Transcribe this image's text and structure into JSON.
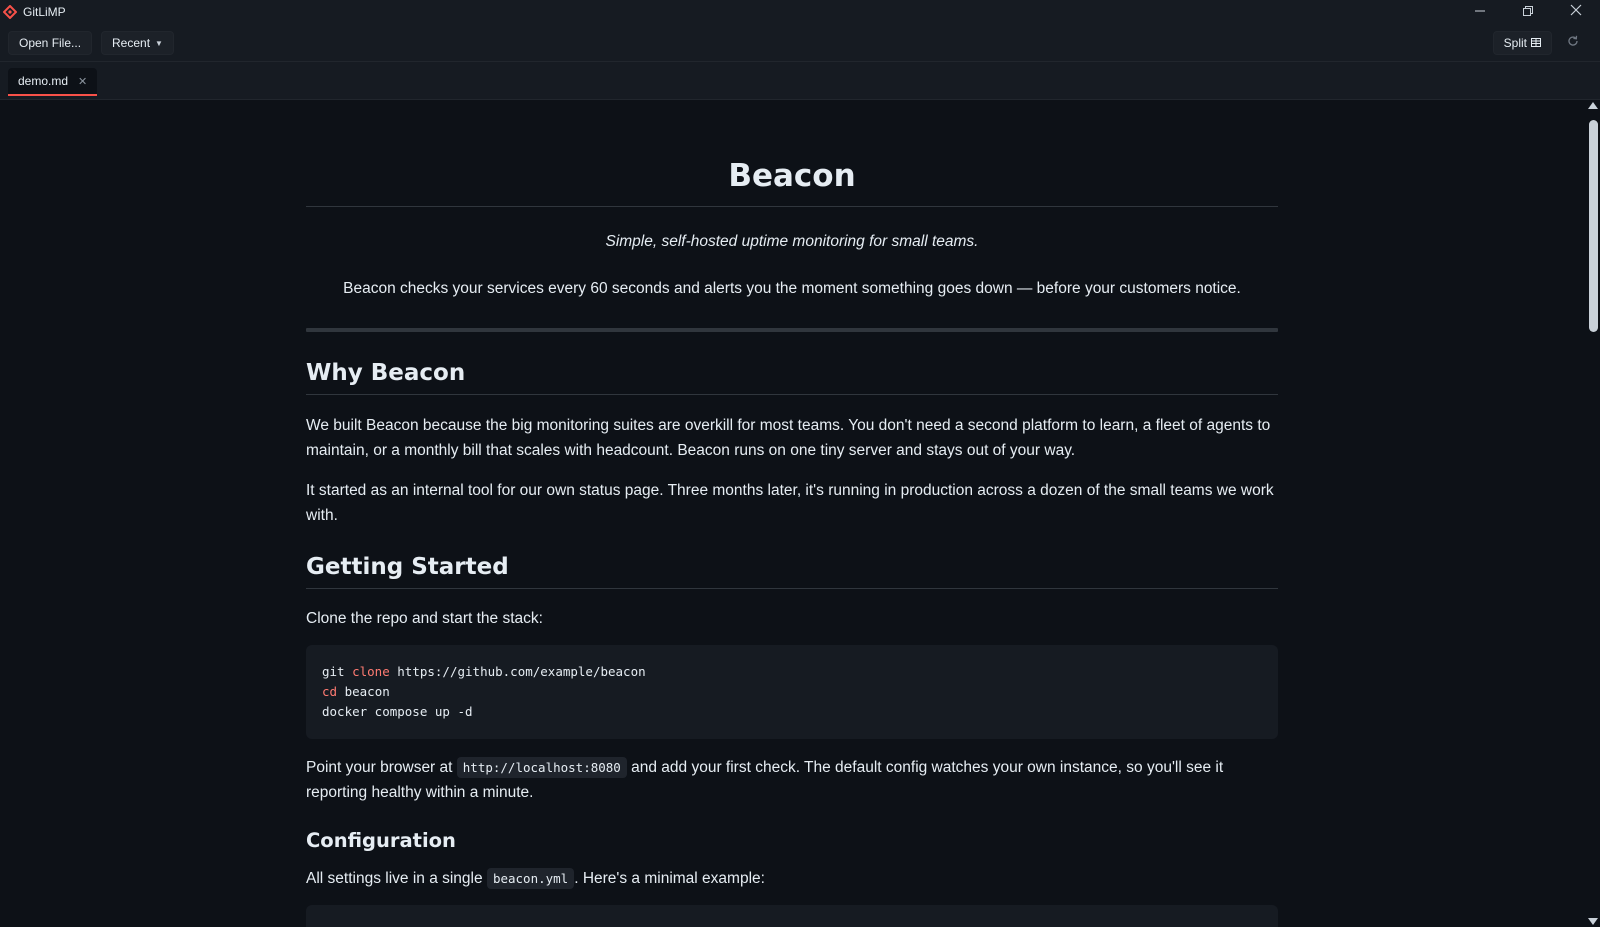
{
  "window": {
    "title": "GitLiMP",
    "icon": "diamond-logo-icon",
    "accent_color": "#f85149"
  },
  "toolbar": {
    "open_file_label": "Open File...",
    "recent_label": "Recent",
    "split_label": "Split"
  },
  "tabs": [
    {
      "label": "demo.md",
      "active": true
    }
  ],
  "document": {
    "title": "Beacon",
    "tagline": "Simple, self-hosted uptime monitoring for small teams.",
    "intro": "Beacon checks your services every 60 seconds and alerts you the moment something goes down — before your customers notice.",
    "why_heading": "Why Beacon",
    "why_p1": "We built Beacon because the big monitoring suites are overkill for most teams. You don't need a second platform to learn, a fleet of agents to maintain, or a monthly bill that scales with headcount. Beacon runs on one tiny server and stays out of your way.",
    "why_p2": "It started as an internal tool for our own status page. Three months later, it's running in production across a dozen of the small teams we work with.",
    "getting_started_heading": "Getting Started",
    "getting_started_intro": "Clone the repo and start the stack:",
    "code": {
      "line1_cmd": "git",
      "line1_kw": "clone",
      "line1_rest": "https://github.com/example/beacon",
      "line2_kw": "cd",
      "line2_rest": "beacon",
      "line3": "docker compose up -d"
    },
    "browser_p_before": "Point your browser at",
    "browser_p_code": "http://localhost:8080",
    "browser_p_after": "and add your first check. The default config watches your own instance, so you'll see it reporting healthy within a minute.",
    "configuration_heading": "Configuration",
    "config_p_before": "All settings live in a single",
    "config_p_code": "beacon.yml",
    "config_p_after": ". Here's a minimal example:"
  }
}
